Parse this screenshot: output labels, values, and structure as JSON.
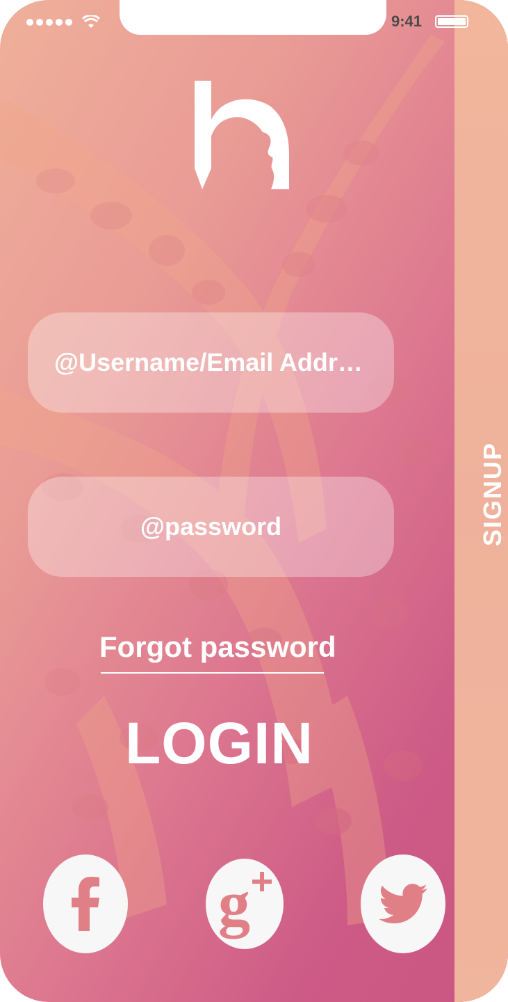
{
  "status_bar": {
    "time": "9:41"
  },
  "login_form": {
    "username_placeholder": "@Username/Email Address",
    "password_placeholder": "@password",
    "forgot_password": "Forgot password",
    "login_button": "LOGIN"
  },
  "signup_tab": {
    "label": "SIGNUP"
  },
  "social": {
    "icons": [
      "facebook-icon",
      "google-plus-icon",
      "twitter-icon"
    ]
  },
  "colors": {
    "gradient_start": "#efb09a",
    "gradient_end": "#c9567f",
    "signup_panel": "#efb19b",
    "social_icon": "#e17f86"
  }
}
